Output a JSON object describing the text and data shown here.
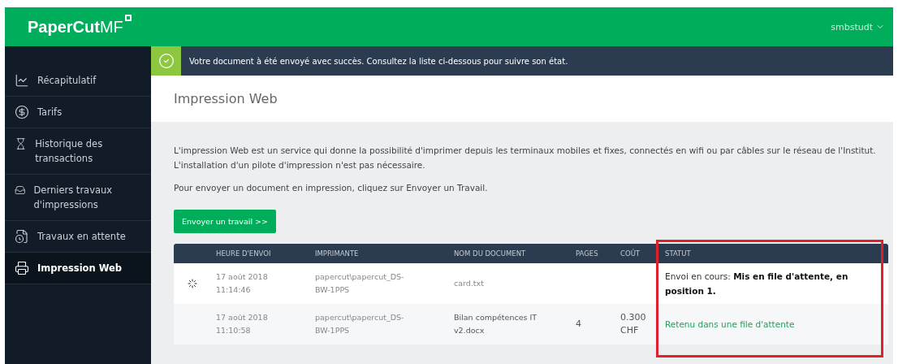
{
  "header": {
    "logo": "PaperCut",
    "logo_suffix": "MF",
    "user": "smbstudt"
  },
  "sidebar": {
    "items": [
      {
        "label": "Récapitulatif",
        "selected": false
      },
      {
        "label": "Tarifs",
        "selected": false
      },
      {
        "label": "Historique des transactions",
        "selected": false
      },
      {
        "label": "Derniers travaux d'impressions",
        "selected": false
      },
      {
        "label": "Travaux en attente",
        "selected": false
      },
      {
        "label": "Impression Web",
        "selected": true
      }
    ]
  },
  "banner": {
    "message": "Votre document à été envoyé avec succès. Consultez la liste ci-dessous pour suivre son état."
  },
  "page": {
    "title": "Impression Web",
    "paragraphs": [
      "L'impression Web est un service qui donne la possibilité d'imprimer depuis les terminaux mobiles et fixes, connectés en wifi ou par câbles sur le réseau de l'Institut. L'installation d'un pilote d'impression n'est pas nécessaire.",
      "Pour envoyer un document en impression, cliquez sur Envoyer un Travail."
    ],
    "button": "Envoyer un travail >>"
  },
  "table": {
    "columns": [
      {
        "label": "HEURE D'ENVOI",
        "highlighted": false
      },
      {
        "label": "IMPRIMANTE",
        "highlighted": false
      },
      {
        "label": "NOM DU DOCUMENT",
        "highlighted": false
      },
      {
        "label": "PAGES",
        "highlighted": false
      },
      {
        "label": "COÛT",
        "highlighted": false
      },
      {
        "label": "STATUT",
        "highlighted": true
      }
    ],
    "rows": [
      {
        "in_progress": true,
        "time": "17 août 2018\n11:14:46",
        "printer": "papercut\\papercut_DS-\nBW-1PPS",
        "document": "card.txt",
        "pages": "",
        "cost": "",
        "status": "Envoi en cours: **Mis en file d'attente, en position 1.**",
        "kind": "progress"
      },
      {
        "in_progress": false,
        "time": "17 août 2018\n11:10:58",
        "printer": "papercut\\papercut_DS-\nBW-1PPS",
        "document": "Bilan compétences IT\nv2.docx",
        "pages": "4",
        "cost": "0.300\nCHF",
        "status": "Retenu dans une file d'attente",
        "kind": "held"
      }
    ]
  }
}
